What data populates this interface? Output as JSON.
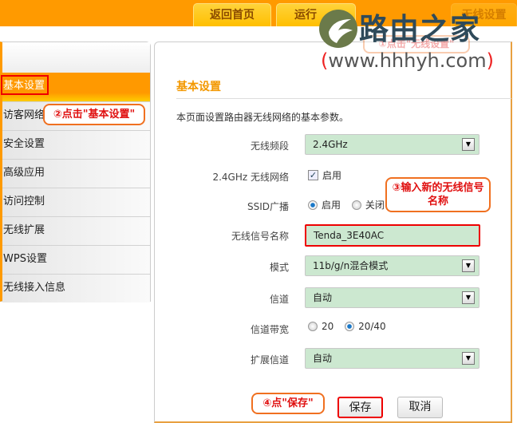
{
  "top_tabs": [
    {
      "label": "返回首页"
    },
    {
      "label": "运行"
    },
    {
      "label": "无线设置"
    }
  ],
  "sidebar": {
    "items": [
      {
        "label": "基本设置",
        "active": true
      },
      {
        "label": "访客网络"
      },
      {
        "label": "安全设置"
      },
      {
        "label": "高级应用"
      },
      {
        "label": "访问控制"
      },
      {
        "label": "无线扩展"
      },
      {
        "label": "WPS设置"
      },
      {
        "label": "无线接入信息"
      }
    ]
  },
  "main": {
    "title": "基本设置",
    "description": "本页面设置路由器无线网络的基本参数。",
    "fields": {
      "band": {
        "label": "无线频段",
        "value": "2.4GHz"
      },
      "network": {
        "label": "2.4GHz 无线网络",
        "option": "启用",
        "checked": true
      },
      "ssid_broadcast": {
        "label": "SSID广播",
        "options": [
          "启用",
          "关闭"
        ],
        "selected": "启用"
      },
      "ssid": {
        "label": "无线信号名称",
        "value": "Tenda_3E40AC"
      },
      "mode": {
        "label": "模式",
        "value": "11b/g/n混合模式"
      },
      "channel": {
        "label": "信道",
        "value": "自动"
      },
      "bandwidth": {
        "label": "信道带宽",
        "options": [
          "20",
          "20/40"
        ],
        "selected": "20/40"
      },
      "ext_channel": {
        "label": "扩展信道",
        "value": "自动"
      }
    },
    "save_label": "保存",
    "cancel_label": "取消"
  },
  "annotations": {
    "step1": "①点击\"无线设置\"",
    "step2": "②点击\"基本设置\"",
    "step3": "③输入新的无线信号名称",
    "step4": "④点\"保存\""
  },
  "watermark": {
    "name": "路由之家",
    "url_open": "(",
    "url": "www.hhhyh.com",
    "url_close": ")"
  },
  "colors": {
    "accent": "#ff9a00",
    "field_bg": "#cce8d0",
    "highlight": "#e00000"
  }
}
